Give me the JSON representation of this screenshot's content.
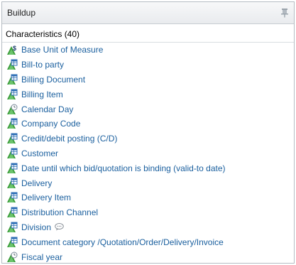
{
  "panel": {
    "title": "Buildup"
  },
  "section": {
    "label": "Characteristics (40)"
  },
  "items": [
    {
      "label": "Base Unit of Measure",
      "icon": "unit-dimension-icon",
      "comment": false
    },
    {
      "label": "Bill-to party",
      "icon": "dimension-table-icon",
      "comment": false
    },
    {
      "label": "Billing Document",
      "icon": "dimension-table-icon",
      "comment": false
    },
    {
      "label": "Billing Item",
      "icon": "dimension-table-icon",
      "comment": false
    },
    {
      "label": "Calendar Day",
      "icon": "time-dimension-icon",
      "comment": false
    },
    {
      "label": "Company Code",
      "icon": "dimension-table-icon",
      "comment": false
    },
    {
      "label": "Credit/debit posting (C/D)",
      "icon": "dimension-table-icon",
      "comment": false
    },
    {
      "label": "Customer",
      "icon": "dimension-table-icon",
      "comment": false
    },
    {
      "label": "Date until which bid/quotation is binding (valid-to date)",
      "icon": "dimension-table-icon",
      "comment": false
    },
    {
      "label": "Delivery",
      "icon": "dimension-table-icon",
      "comment": false
    },
    {
      "label": "Delivery Item",
      "icon": "dimension-table-icon",
      "comment": false
    },
    {
      "label": "Distribution Channel",
      "icon": "dimension-table-icon",
      "comment": false
    },
    {
      "label": "Division",
      "icon": "dimension-table-icon",
      "comment": true
    },
    {
      "label": "Document category /Quotation/Order/Delivery/Invoice",
      "icon": "dimension-table-icon",
      "comment": false
    },
    {
      "label": "Fiscal year",
      "icon": "time-dimension-icon",
      "comment": false
    }
  ],
  "colors": {
    "link": "#1a5f9e",
    "icon_green": "#3a9b3a",
    "icon_blue": "#2f6fb6"
  }
}
